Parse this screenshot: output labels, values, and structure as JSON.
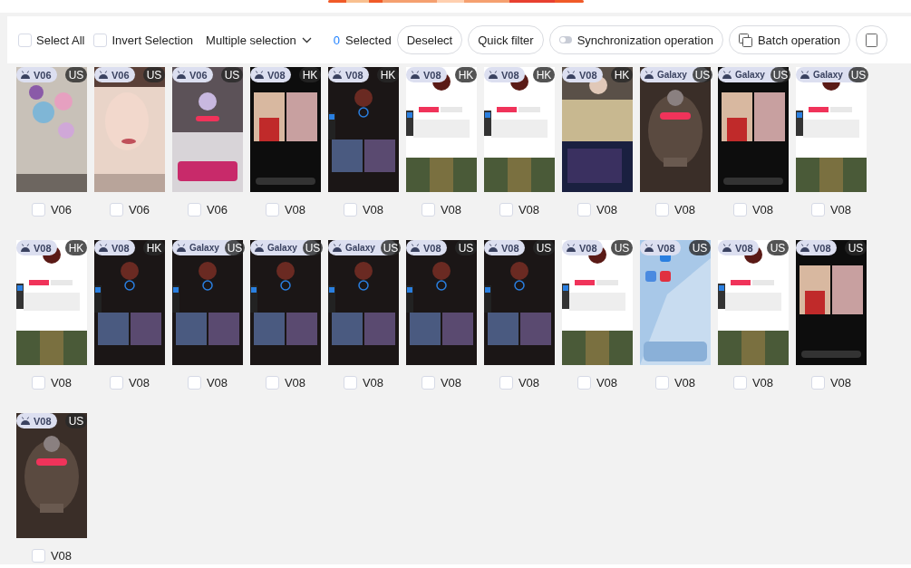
{
  "toolbar": {
    "select_all": {
      "label": "Select All",
      "checked": false
    },
    "invert_selection": {
      "label": "Invert Selection",
      "checked": false
    },
    "mode_dropdown": {
      "label": "Multiple selection"
    },
    "selected_count": "0",
    "selected_label": "Selected",
    "buttons": [
      {
        "kind": "plain",
        "label": "Deselect"
      },
      {
        "kind": "plain",
        "label": "Quick filter"
      },
      {
        "kind": "toggle",
        "label": "Synchronization operation"
      },
      {
        "kind": "copy",
        "label": "Batch operation"
      },
      {
        "kind": "cut"
      }
    ]
  },
  "devices": [
    {
      "model": "V06",
      "region": "US",
      "name": "V06",
      "checked": false
    },
    {
      "model": "V06",
      "region": "US",
      "name": "V06",
      "checked": false
    },
    {
      "model": "V06",
      "region": "US",
      "name": "V06",
      "checked": false
    },
    {
      "model": "V08",
      "region": "HK",
      "name": "V08",
      "checked": false
    },
    {
      "model": "V08",
      "region": "HK",
      "name": "V08",
      "checked": false
    },
    {
      "model": "V08",
      "region": "HK",
      "name": "V08",
      "checked": false
    },
    {
      "model": "V08",
      "region": "HK",
      "name": "V08",
      "checked": false
    },
    {
      "model": "V08",
      "region": "HK",
      "name": "V08",
      "checked": false
    },
    {
      "model": "Galaxy",
      "region": "US",
      "name": "V08",
      "checked": false
    },
    {
      "model": "Galaxy",
      "region": "US",
      "name": "V08",
      "checked": false
    },
    {
      "model": "Galaxy",
      "region": "US",
      "name": "V08",
      "checked": false
    },
    {
      "model": "V08",
      "region": "HK",
      "name": "V08",
      "checked": false
    },
    {
      "model": "V08",
      "region": "HK",
      "name": "V08",
      "checked": false
    },
    {
      "model": "Galaxy",
      "region": "US",
      "name": "V08",
      "checked": false
    },
    {
      "model": "Galaxy",
      "region": "US",
      "name": "V08",
      "checked": false
    },
    {
      "model": "Galaxy",
      "region": "US",
      "name": "V08",
      "checked": false
    },
    {
      "model": "V08",
      "region": "US",
      "name": "V08",
      "checked": false
    },
    {
      "model": "V08",
      "region": "US",
      "name": "V08",
      "checked": false
    },
    {
      "model": "V08",
      "region": "US",
      "name": "V08",
      "checked": false
    },
    {
      "model": "V08",
      "region": "US",
      "name": "V08",
      "checked": false
    },
    {
      "model": "V08",
      "region": "US",
      "name": "V08",
      "checked": false
    },
    {
      "model": "V08",
      "region": "US",
      "name": "V08",
      "checked": false
    },
    {
      "model": "V08",
      "region": "US",
      "name": "V08",
      "checked": false
    }
  ]
}
